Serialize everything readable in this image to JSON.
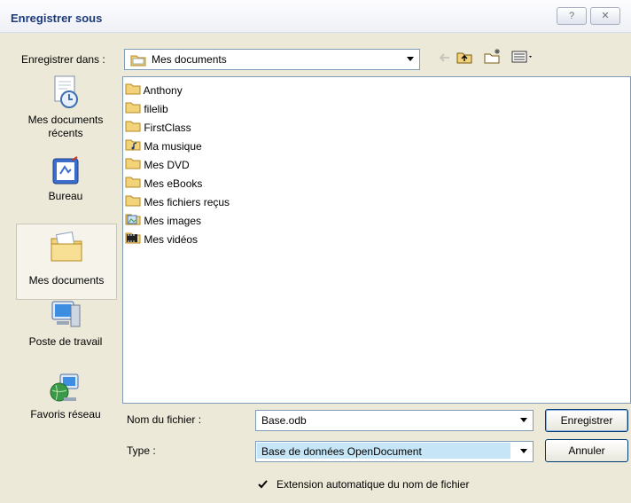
{
  "window": {
    "title": "Enregistrer sous",
    "help_label": "?",
    "close_label": "✕"
  },
  "location": {
    "label": "Enregistrer dans :",
    "value": "Mes documents"
  },
  "places": [
    {
      "label": "Mes documents récents"
    },
    {
      "label": "Bureau"
    },
    {
      "label": "Mes documents"
    },
    {
      "label": "Poste de travail"
    },
    {
      "label": "Favoris réseau"
    }
  ],
  "files": [
    {
      "name": "Anthony",
      "icon": "folder"
    },
    {
      "name": "filelib",
      "icon": "folder"
    },
    {
      "name": "FirstClass",
      "icon": "folder"
    },
    {
      "name": "Ma musique",
      "icon": "music-folder"
    },
    {
      "name": "Mes DVD",
      "icon": "folder"
    },
    {
      "name": "Mes eBooks",
      "icon": "folder"
    },
    {
      "name": "Mes fichiers reçus",
      "icon": "folder"
    },
    {
      "name": "Mes images",
      "icon": "pictures-folder"
    },
    {
      "name": "Mes vidéos",
      "icon": "video-folder"
    }
  ],
  "filename": {
    "label": "Nom du fichier :",
    "value": "Base.odb"
  },
  "filetype": {
    "label": "Type :",
    "value": "Base de données OpenDocument"
  },
  "auto_extension": {
    "label": "Extension automatique du nom de fichier",
    "checked": true
  },
  "buttons": {
    "save": "Enregistrer",
    "cancel": "Annuler"
  },
  "colors": {
    "title": "#1d3a7a",
    "folder": "#f3d37a",
    "selection": "#c6e6f7"
  }
}
